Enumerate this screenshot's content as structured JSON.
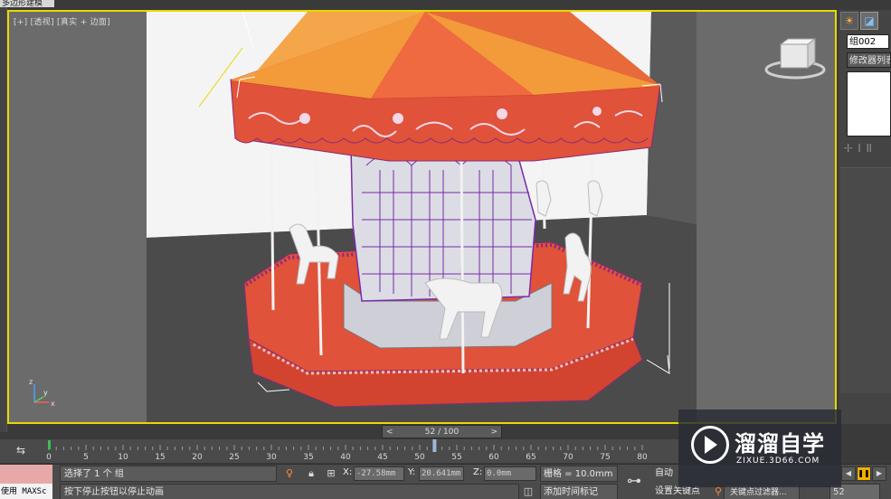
{
  "window": {
    "title": "多边形建模"
  },
  "viewport": {
    "label": "[+] [透视] [真实 + 边面]",
    "axis_labels": {
      "x": "x",
      "y": "y",
      "z": "z"
    }
  },
  "command_panel": {
    "tabs": [
      {
        "icon": "sun-icon"
      },
      {
        "icon": "modify-icon"
      }
    ],
    "object_name": "组002",
    "modifier_list": "修改器列表",
    "stack_tools": [
      "-|-",
      "|",
      "||"
    ]
  },
  "time_slider": {
    "prev": "<",
    "label": "52 / 100",
    "next": ">"
  },
  "trackbar": {
    "ticks": [
      0,
      5,
      10,
      15,
      20,
      25,
      30,
      35,
      40,
      45,
      50,
      55,
      60,
      65,
      70,
      75,
      80
    ],
    "current_frame": 52
  },
  "status": {
    "maxscript_label": "使用 MAXSc",
    "selection_text": "选择了 1 个 组",
    "prompt_text": "按下停止按钮以停止动画",
    "coords": {
      "x_label": "X:",
      "x": "-27.58mm",
      "y_label": "Y:",
      "y": "20.641mm",
      "z_label": "Z:",
      "z": "0.0mm"
    },
    "grid": "栅格 = 10.0mm",
    "add_time_tag": "添加时间标记",
    "auto_key": "自动",
    "set_key": "设置关键点",
    "key_filters": "关键点过滤器...",
    "frame_value": "52"
  },
  "watermark": {
    "title": "溜溜自学",
    "url": "ZIXUE.3D66.COM"
  },
  "colors": {
    "viewport_border": "#e8d800",
    "carousel_red": "#e0523a",
    "carousel_orange": "#f39a3a",
    "wire_purple": "#7a2aa8"
  }
}
